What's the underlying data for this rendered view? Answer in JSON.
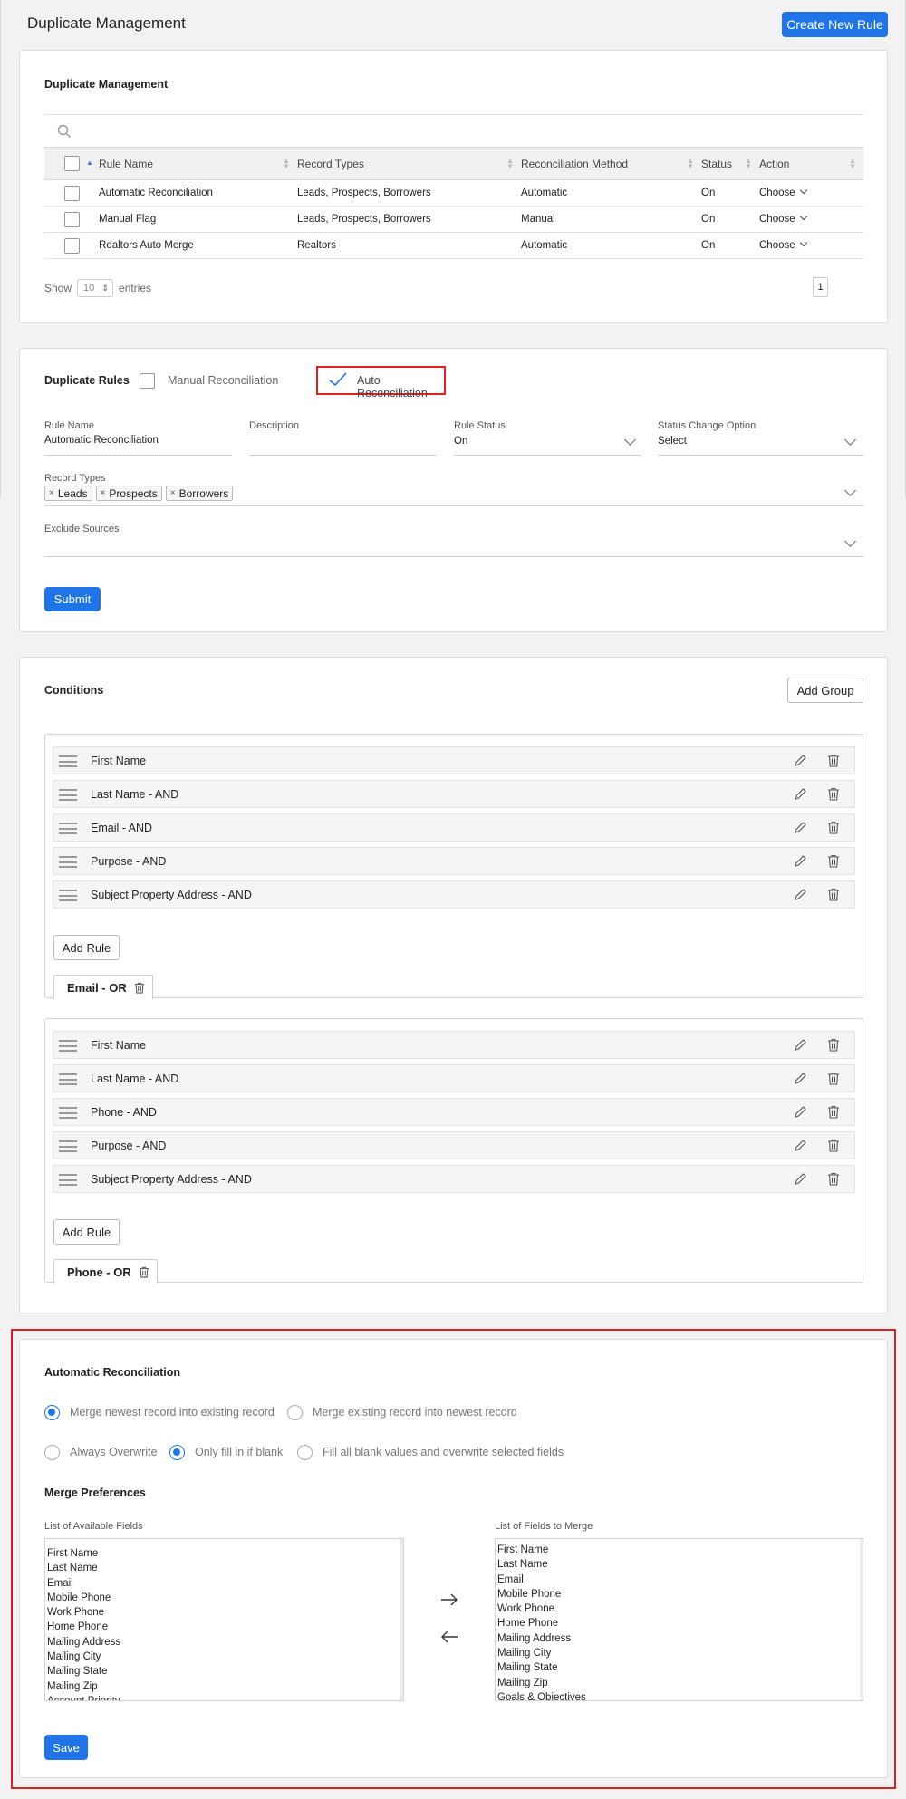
{
  "header": {
    "title": "Duplicate Management",
    "create_button": "Create New Rule"
  },
  "management": {
    "title": "Duplicate Management",
    "columns": [
      "Rule Name",
      "Record Types",
      "Reconciliation Method",
      "Status",
      "Action"
    ],
    "rows": [
      {
        "name": "Automatic Reconciliation",
        "types": "Leads, Prospects, Borrowers",
        "method": "Automatic",
        "status": "On",
        "action": "Choose"
      },
      {
        "name": "Manual Flag",
        "types": "Leads, Prospects, Borrowers",
        "method": "Manual",
        "status": "On",
        "action": "Choose"
      },
      {
        "name": "Realtors Auto Merge",
        "types": "Realtors",
        "method": "Automatic",
        "status": "On",
        "action": "Choose"
      }
    ],
    "show_label": "Show",
    "show_value": "10",
    "entries_label": "entries",
    "page": "1"
  },
  "rules": {
    "title": "Duplicate Rules",
    "manual_label": "Manual Reconciliation",
    "auto_label": "Auto Reconciliation",
    "rule_name_label": "Rule Name",
    "rule_name_value": "Automatic Reconciliation",
    "description_label": "Description",
    "description_value": "",
    "status_label": "Rule Status",
    "status_value": "On",
    "status_change_label": "Status Change Option",
    "status_change_value": "Select",
    "record_types_label": "Record Types",
    "record_types": [
      "Leads",
      "Prospects",
      "Borrowers"
    ],
    "exclude_label": "Exclude Sources",
    "submit": "Submit"
  },
  "conditions": {
    "title": "Conditions",
    "add_group": "Add Group",
    "add_rule": "Add Rule",
    "groups": [
      {
        "tab": "Email - OR",
        "items": [
          "First Name",
          "Last Name - AND",
          "Email - AND",
          "Purpose - AND",
          "Subject Property Address - AND"
        ]
      },
      {
        "tab": "Phone - OR",
        "items": [
          "First Name",
          "Last Name - AND",
          "Phone - AND",
          "Purpose - AND",
          "Subject Property Address - AND"
        ]
      }
    ]
  },
  "auto_recon": {
    "title": "Automatic Reconciliation",
    "merge_options": [
      "Merge newest record into existing record",
      "Merge existing record into newest record"
    ],
    "overwrite_options": [
      "Always Overwrite",
      "Only fill in if blank",
      "Fill all blank values and overwrite selected fields"
    ],
    "merge_prefs_title": "Merge Preferences",
    "available_label": "List of Available Fields",
    "merge_label": "List of Fields to Merge",
    "available_fields": [
      "First Name",
      "Last Name",
      "Email",
      "Mobile Phone",
      "Work Phone",
      "Home Phone",
      "Mailing Address",
      "Mailing City",
      "Mailing State",
      "Mailing Zip",
      "Account Priority"
    ],
    "merge_fields": [
      "First Name",
      "Last Name",
      "Email",
      "Mobile Phone",
      "Work Phone",
      "Home Phone",
      "Mailing Address",
      "Mailing City",
      "Mailing State",
      "Mailing Zip",
      "Goals & Objectives"
    ],
    "save": "Save"
  },
  "colors": {
    "primary": "#1f74e8",
    "highlight": "#e02020"
  }
}
